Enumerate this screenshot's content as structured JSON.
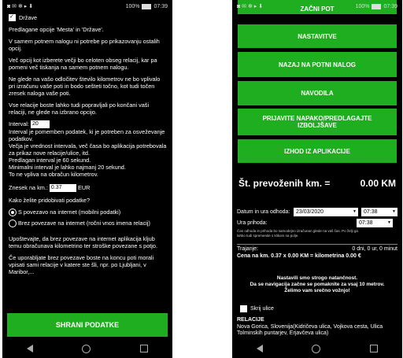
{
  "status": {
    "left_icons": "◙ ✉ ✻ ▸ ⬇",
    "battery": "100%",
    "time": "07:39"
  },
  "left": {
    "drzave_label": "Države",
    "para1": "Predlagane opcije 'Mesta' in 'Države'.",
    "para2": "V samem potnem nalogu ni potrebe po prikazovanju ostalih opcij.",
    "para3": "Več opcij kot izberete večji bo celoten obseg relacij, kar pa pomeni več tiskanja na samem potnem nalogu.",
    "para4": "Ne glede na vašo odločitev število kilometrov ne bo vplivalo pri izračunu vaše poti in bodo sešteti točno, kot tudi točen zresek naloga vaše poti.",
    "para5": "Vse relacije boste lahko tudi popravljali po končani vaši relaciji, ne glede na izbrano opcijo.",
    "interval_label": "Interval:",
    "interval_value": "20",
    "interval_text": "Interval je pomemben podatek, ki je potreben za osveževanje podatkov.\nVečja je vrednost intervala, več časa bo aplikacija potrebovala za prikaz nove relacije/ulice, itd.\nPredlagan interval je 60 sekund.\nMinimalni interval je lahko najmanj 20 sekund.\nTo ne vpliva na obračun kilometrov.",
    "znesek_label": "Znesek na km.:",
    "znesek_value": "0.37",
    "znesek_unit": "EUR",
    "kako_label": "Kako želite pridobivati podatke?",
    "radio1": "S povezavo na internet (mobilni podatki)",
    "radio2": "Brez povezave na internet (ročni vnos imena relacij)",
    "para6": "Upoštevajte, da brez povezave na internet aplikacija kljub temu obračunava kilometrino ter stroške povezane s potjo.",
    "para7": "Če uporabljate brez povezave boste na koncu poti morali vpisati sami relacije v katere ste šli, npr. po Ljubljani, v Maribor,...",
    "save_button": "SHRANI PODATKE"
  },
  "right": {
    "btn_top": "ZAČNI POT",
    "btn_nastavitve": "NASTAVITVE",
    "btn_nazaj": "NAZAJ NA POTNI NALOG",
    "btn_navodila": "NAVODILA",
    "btn_prijavite": "PRIJAVITE NAPAKO/PREDLAGAJTE IZBOLJŠAVE",
    "btn_izhod": "IZHOD IZ APLIKACIJE",
    "km_label": "Št. prevoženih km. =",
    "km_value": "0.00 KM",
    "datum_label": "Datum in ura odhoda:",
    "datum_value": "23/03/2020",
    "ura_odhoda_value": "07:38",
    "ura_prihoda_label": "Ura prihoda:",
    "ura_prihoda_value": "07:38",
    "note": "Čas odhoda in prihoda bo samodejno izračunan glede na vaš čas. Po želji ga lahko tudi spremenite s klikom na polje.",
    "trajanje_label": "Trajanje:",
    "trajanje_value": "0 dni, 0 ur, 0 minut",
    "cena_label": "Cena na km. 0.37 x 0.00 KM = kilometrina 0.00 €",
    "nastavili": "Nastavili smo strogo natančnost.\nDa se navigacija začne se pomaknite za vsaj 10 metrov.\nŽelimo vam srečno vožnjo!",
    "skrij_label": "Skrij ulice",
    "relacije_title": "RELACIJE",
    "relacije_text": "Nova Gorica, Slovenija(Kidričeva ulica, Vojkova cesta, Ulica Tolminskih puntarjev, Erjavčeva ulica)"
  }
}
